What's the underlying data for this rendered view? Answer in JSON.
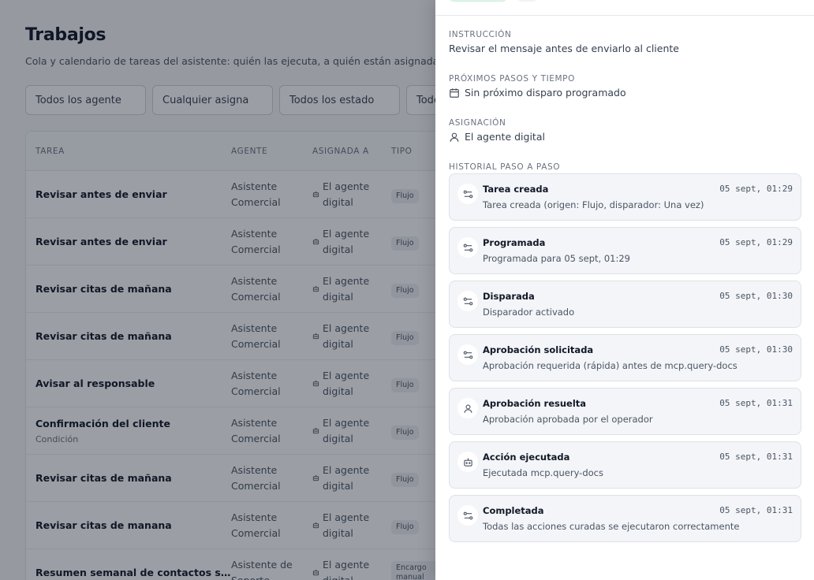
{
  "page": {
    "title": "Trabajos",
    "subtitle": "Cola y calendario de tareas del asistente: quién las ejecuta, a quién están asignadas y que"
  },
  "filters": [
    {
      "value": "Todos los agente"
    },
    {
      "value": "Cualquier asigna"
    },
    {
      "value": "Todos los estado"
    },
    {
      "value": "Todo"
    }
  ],
  "table": {
    "headers": {
      "task": "TAREA",
      "agent": "AGENTE",
      "assigned": "ASIGNADA A",
      "type": "TIPO"
    },
    "rows": [
      {
        "task": "Revisar antes de enviar",
        "sub": "",
        "agent_1": "Asistente",
        "agent_2": "Comercial",
        "assigned_1": "El agente",
        "assigned_2": "digital",
        "type": "Flujo"
      },
      {
        "task": "Revisar antes de enviar",
        "sub": "",
        "agent_1": "Asistente",
        "agent_2": "Comercial",
        "assigned_1": "El agente",
        "assigned_2": "digital",
        "type": "Flujo"
      },
      {
        "task": "Revisar citas de mañana",
        "sub": "",
        "agent_1": "Asistente",
        "agent_2": "Comercial",
        "assigned_1": "El agente",
        "assigned_2": "digital",
        "type": "Flujo"
      },
      {
        "task": "Revisar citas de mañana",
        "sub": "",
        "agent_1": "Asistente",
        "agent_2": "Comercial",
        "assigned_1": "El agente",
        "assigned_2": "digital",
        "type": "Flujo"
      },
      {
        "task": "Avisar al responsable",
        "sub": "",
        "agent_1": "Asistente",
        "agent_2": "Comercial",
        "assigned_1": "El agente",
        "assigned_2": "digital",
        "type": "Flujo"
      },
      {
        "task": "Confirmación del cliente",
        "sub": "Condición",
        "agent_1": "Asistente",
        "agent_2": "Comercial",
        "assigned_1": "El agente",
        "assigned_2": "digital",
        "type": "Flujo"
      },
      {
        "task": "Revisar citas de mañana",
        "sub": "",
        "agent_1": "Asistente",
        "agent_2": "Comercial",
        "assigned_1": "El agente",
        "assigned_2": "digital",
        "type": "Flujo"
      },
      {
        "task": "Revisar citas de manana",
        "sub": "",
        "agent_1": "Asistente",
        "agent_2": "Comercial",
        "assigned_1": "El agente",
        "assigned_2": "digital",
        "type": "Flujo"
      },
      {
        "task": "Resumen semanal de contactos sin res...",
        "sub": "",
        "agent_1": "Asistente de",
        "agent_2": "Soporte",
        "assigned_1": "El agente",
        "assigned_2": "digital",
        "type": "Encargo manual"
      }
    ]
  },
  "drawer": {
    "instruction": {
      "label": "INSTRUCCIÓN",
      "value": "Revisar el mensaje antes de enviarlo al cliente"
    },
    "next_steps": {
      "label": "PRÓXIMOS PASOS Y TIEMPO",
      "value": "Sin próximo disparo programado",
      "icon": "calendar-icon"
    },
    "assignment": {
      "label": "ASIGNACIÓN",
      "value": "El agente digital",
      "icon": "user-icon"
    },
    "history_label": "HISTORIAL PASO A PASO",
    "history": [
      {
        "title": "Tarea creada",
        "desc": "Tarea creada (origen: Flujo, disparador: Una vez)",
        "time": "05 sept, 01:29",
        "icon": "flow-icon"
      },
      {
        "title": "Programada",
        "desc": "Programada para 05 sept, 01:29",
        "time": "05 sept, 01:29",
        "icon": "flow-icon"
      },
      {
        "title": "Disparada",
        "desc": "Disparador activado",
        "time": "05 sept, 01:30",
        "icon": "flow-icon"
      },
      {
        "title": "Aprobación solicitada",
        "desc": "Aprobación requerida (rápida) antes de mcp.query-docs",
        "time": "05 sept, 01:30",
        "icon": "flow-icon"
      },
      {
        "title": "Aprobación resuelta",
        "desc": "Aprobación aprobada por el operador",
        "time": "05 sept, 01:31",
        "icon": "user-icon"
      },
      {
        "title": "Acción ejecutada",
        "desc": "Ejecutada mcp.query-docs",
        "time": "05 sept, 01:31",
        "icon": "bot-icon"
      },
      {
        "title": "Completada",
        "desc": "Todas las acciones curadas se ejecutaron correctamente",
        "time": "05 sept, 01:31",
        "icon": "flow-icon"
      }
    ]
  }
}
